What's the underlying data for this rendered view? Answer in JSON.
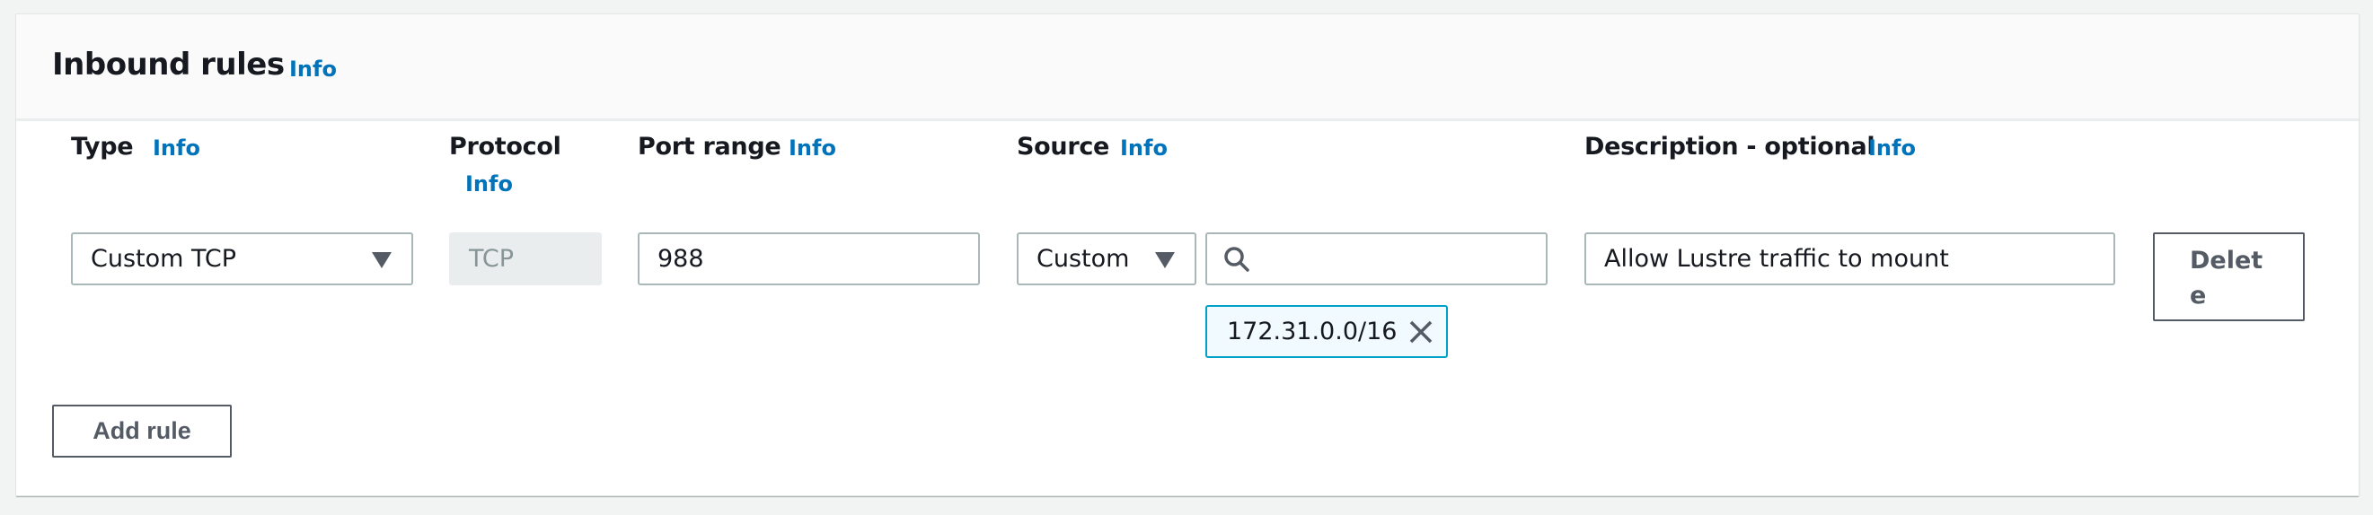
{
  "section": {
    "title": "Inbound rules",
    "info_label": "Info"
  },
  "columns": {
    "type": {
      "label": "Type",
      "info": "Info"
    },
    "protocol": {
      "label": "Protocol",
      "info": "Info"
    },
    "port_range": {
      "label": "Port range",
      "info": "Info"
    },
    "source": {
      "label": "Source",
      "info": "Info"
    },
    "description": {
      "label": "Description - optional",
      "info": "Info"
    }
  },
  "rules": [
    {
      "type": "Custom TCP",
      "protocol": "TCP",
      "port_range": "988",
      "source_type": "Custom",
      "source_search": "",
      "source_tokens": [
        "172.31.0.0/16"
      ],
      "description": "Allow Lustre traffic to mount",
      "delete_label_line1": "Delet",
      "delete_label_line2": "e"
    }
  ],
  "add_rule_label": "Add rule",
  "colors": {
    "link": "#0073bb",
    "token_border": "#00a1c9",
    "token_bg": "#f1faff"
  },
  "icons": {
    "dropdown": "caret-down-icon",
    "search": "search-icon",
    "remove_token": "close-icon"
  }
}
